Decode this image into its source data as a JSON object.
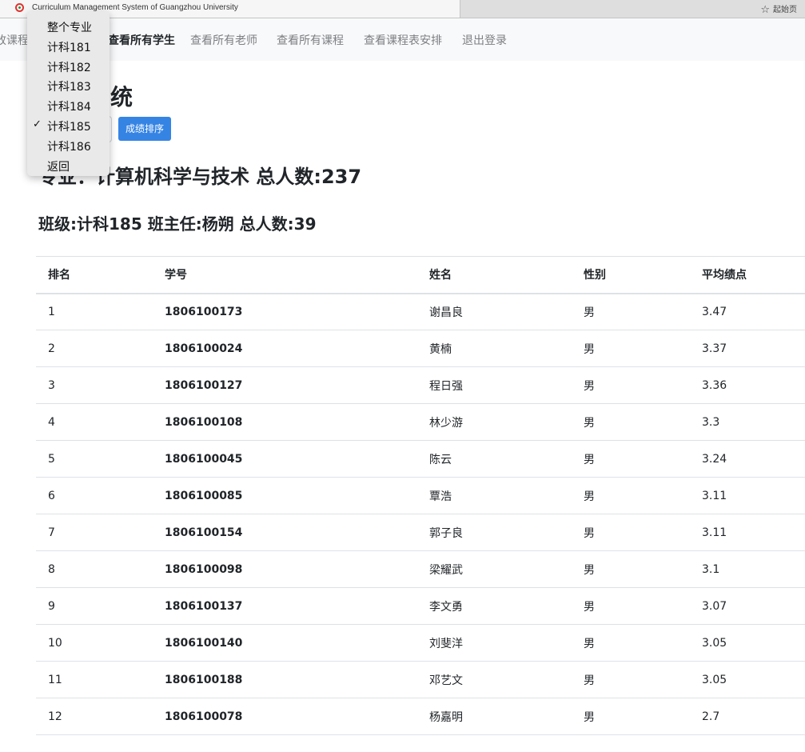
{
  "browser": {
    "tab_title": "Curriculum Management System of Guangzhou University",
    "bookmark_label": "起始页",
    "bookmark_icon": "star-icon"
  },
  "nav": {
    "items": [
      {
        "label": "改课程",
        "active": false
      },
      {
        "label": "查看所有学生",
        "active": true
      },
      {
        "label": "查看所有老师",
        "active": false
      },
      {
        "label": "查看所有课程",
        "active": false
      },
      {
        "label": "查看课程表安排",
        "active": false
      },
      {
        "label": "退出登录",
        "active": false
      }
    ]
  },
  "page": {
    "title_fragment": "统",
    "sort_button": "成绩排序",
    "major_heading": "专业：计算机科学与技术 总人数:237",
    "class_heading": "班级:计科185 班主任:杨朔 总人数:39"
  },
  "dropdown": {
    "options": [
      {
        "label": "整个专业",
        "checked": false
      },
      {
        "label": "计科181",
        "checked": false
      },
      {
        "label": "计科182",
        "checked": false
      },
      {
        "label": "计科183",
        "checked": false
      },
      {
        "label": "计科184",
        "checked": false
      },
      {
        "label": "计科185",
        "checked": true
      },
      {
        "label": "计科186",
        "checked": false
      },
      {
        "label": "返回",
        "checked": false
      }
    ],
    "check_glyph": "✓"
  },
  "table": {
    "columns": [
      "排名",
      "学号",
      "姓名",
      "性别",
      "平均绩点"
    ],
    "rows": [
      [
        "1",
        "1806100173",
        "谢昌良",
        "男",
        "3.47"
      ],
      [
        "2",
        "1806100024",
        "黄楠",
        "男",
        "3.37"
      ],
      [
        "3",
        "1806100127",
        "程日强",
        "男",
        "3.36"
      ],
      [
        "4",
        "1806100108",
        "林少游",
        "男",
        "3.3"
      ],
      [
        "5",
        "1806100045",
        "陈云",
        "男",
        "3.24"
      ],
      [
        "6",
        "1806100085",
        "覃浩",
        "男",
        "3.11"
      ],
      [
        "7",
        "1806100154",
        "郭子良",
        "男",
        "3.11"
      ],
      [
        "8",
        "1806100098",
        "梁耀武",
        "男",
        "3.1"
      ],
      [
        "9",
        "1806100137",
        "李文勇",
        "男",
        "3.07"
      ],
      [
        "10",
        "1806100140",
        "刘斐洋",
        "男",
        "3.05"
      ],
      [
        "11",
        "1806100188",
        "邓艺文",
        "男",
        "3.05"
      ],
      [
        "12",
        "1806100078",
        "杨嘉明",
        "男",
        "2.7"
      ]
    ]
  }
}
